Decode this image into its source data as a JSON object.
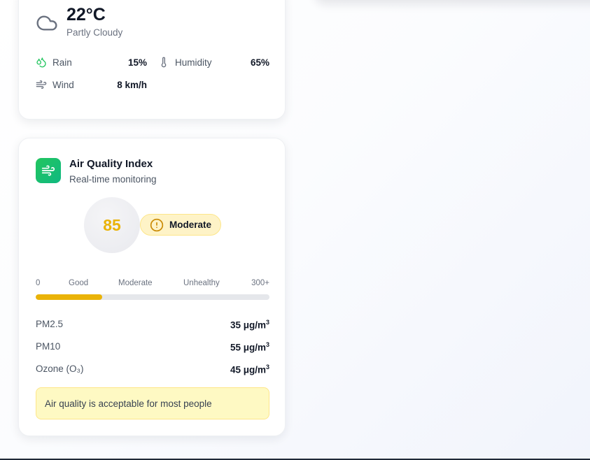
{
  "weather": {
    "temperature": "22°C",
    "condition": "Partly Cloudy",
    "icon": "cloud-icon",
    "stats": [
      {
        "label": "Rain",
        "value": "15%",
        "icon": "droplets-icon",
        "color": "#22c55e"
      },
      {
        "label": "Humidity",
        "value": "65%",
        "icon": "thermometer-icon"
      },
      {
        "label": "Wind",
        "value": "8 km/h",
        "icon": "wind-icon"
      }
    ]
  },
  "aqi": {
    "title": "Air Quality Index",
    "subtitle": "Real-time monitoring",
    "value": "85",
    "status": "Moderate",
    "status_color": "#eab308",
    "scale_labels": [
      "0",
      "Good",
      "Moderate",
      "Unhealthy",
      "300+"
    ],
    "scale_progress_fraction": 0.283,
    "pollutants": [
      {
        "name": "PM2.5",
        "value": "35 μg/m",
        "unit_sup": "3"
      },
      {
        "name": "PM10",
        "value": "55 μg/m",
        "unit_sup": "3"
      },
      {
        "name": "Ozone (O₃)",
        "value": "45 μg/m",
        "unit_sup": "3"
      }
    ],
    "advice": "Air quality is acceptable for most people"
  }
}
